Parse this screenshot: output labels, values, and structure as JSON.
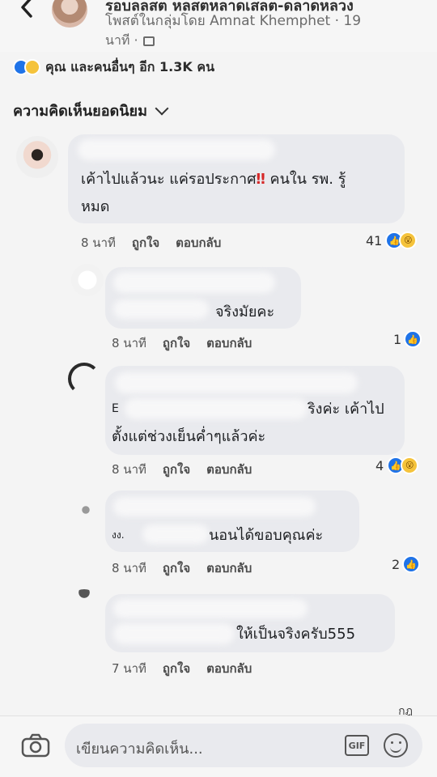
{
  "header": {
    "title": "รอบ​ลล​สต​ ห​ล​สต​ห​ลา​ดเ​สลต​-​ดลาด​ห​ลวง",
    "posted_in": "โพสต์ในกลุ่มโดย Amnat Khemphet · 19",
    "time": "นาที ·"
  },
  "reactions_summary": "คุณ และคนอื่นๆ อีก 1.3K คน",
  "sort_label": "ความคิดเห็นยอดนิยม",
  "comments": [
    {
      "text1": "เค้าไปแล้วนะ แค่รอประกาศ",
      "excl": "‼",
      "text1b": " คนใน รพ. รู้",
      "text2": "หมด",
      "time": "8 นาที",
      "like": "ถูกใจ",
      "reply": "ตอบกลับ",
      "count": "41"
    },
    {
      "text1": "จริงมัยคะ",
      "time": "8 นาที",
      "like": "ถูกใจ",
      "reply": "ตอบกลับ",
      "count": "1"
    },
    {
      "prefix": "E",
      "text1": "ริงค่ะ เค้าไป",
      "text2": "ตั้งแต่ช่วงเย็นค่ำๆแล้วค่ะ",
      "time": "8 นาที",
      "like": "ถูกใจ",
      "reply": "ตอบกลับ",
      "count": "4"
    },
    {
      "prefix": "งง.",
      "text1": "นอนได้ขอบคุณค่ะ",
      "time": "8 นาที",
      "like": "ถูกใจ",
      "reply": "ตอบกลับ",
      "count": "2"
    },
    {
      "text1": "ให้เป็นจริงครับ555",
      "time": "7 นาที",
      "like": "ถูกใจ",
      "reply": "ตอบกลับ"
    }
  ],
  "footer_label": "กฎ",
  "composer": {
    "placeholder": "เขียนความคิดเห็น...",
    "gif": "GIF"
  },
  "colors": {
    "like_blue": "#1f73e8",
    "wow_yellow": "#f5c33b",
    "bubble": "#e9eaee"
  }
}
